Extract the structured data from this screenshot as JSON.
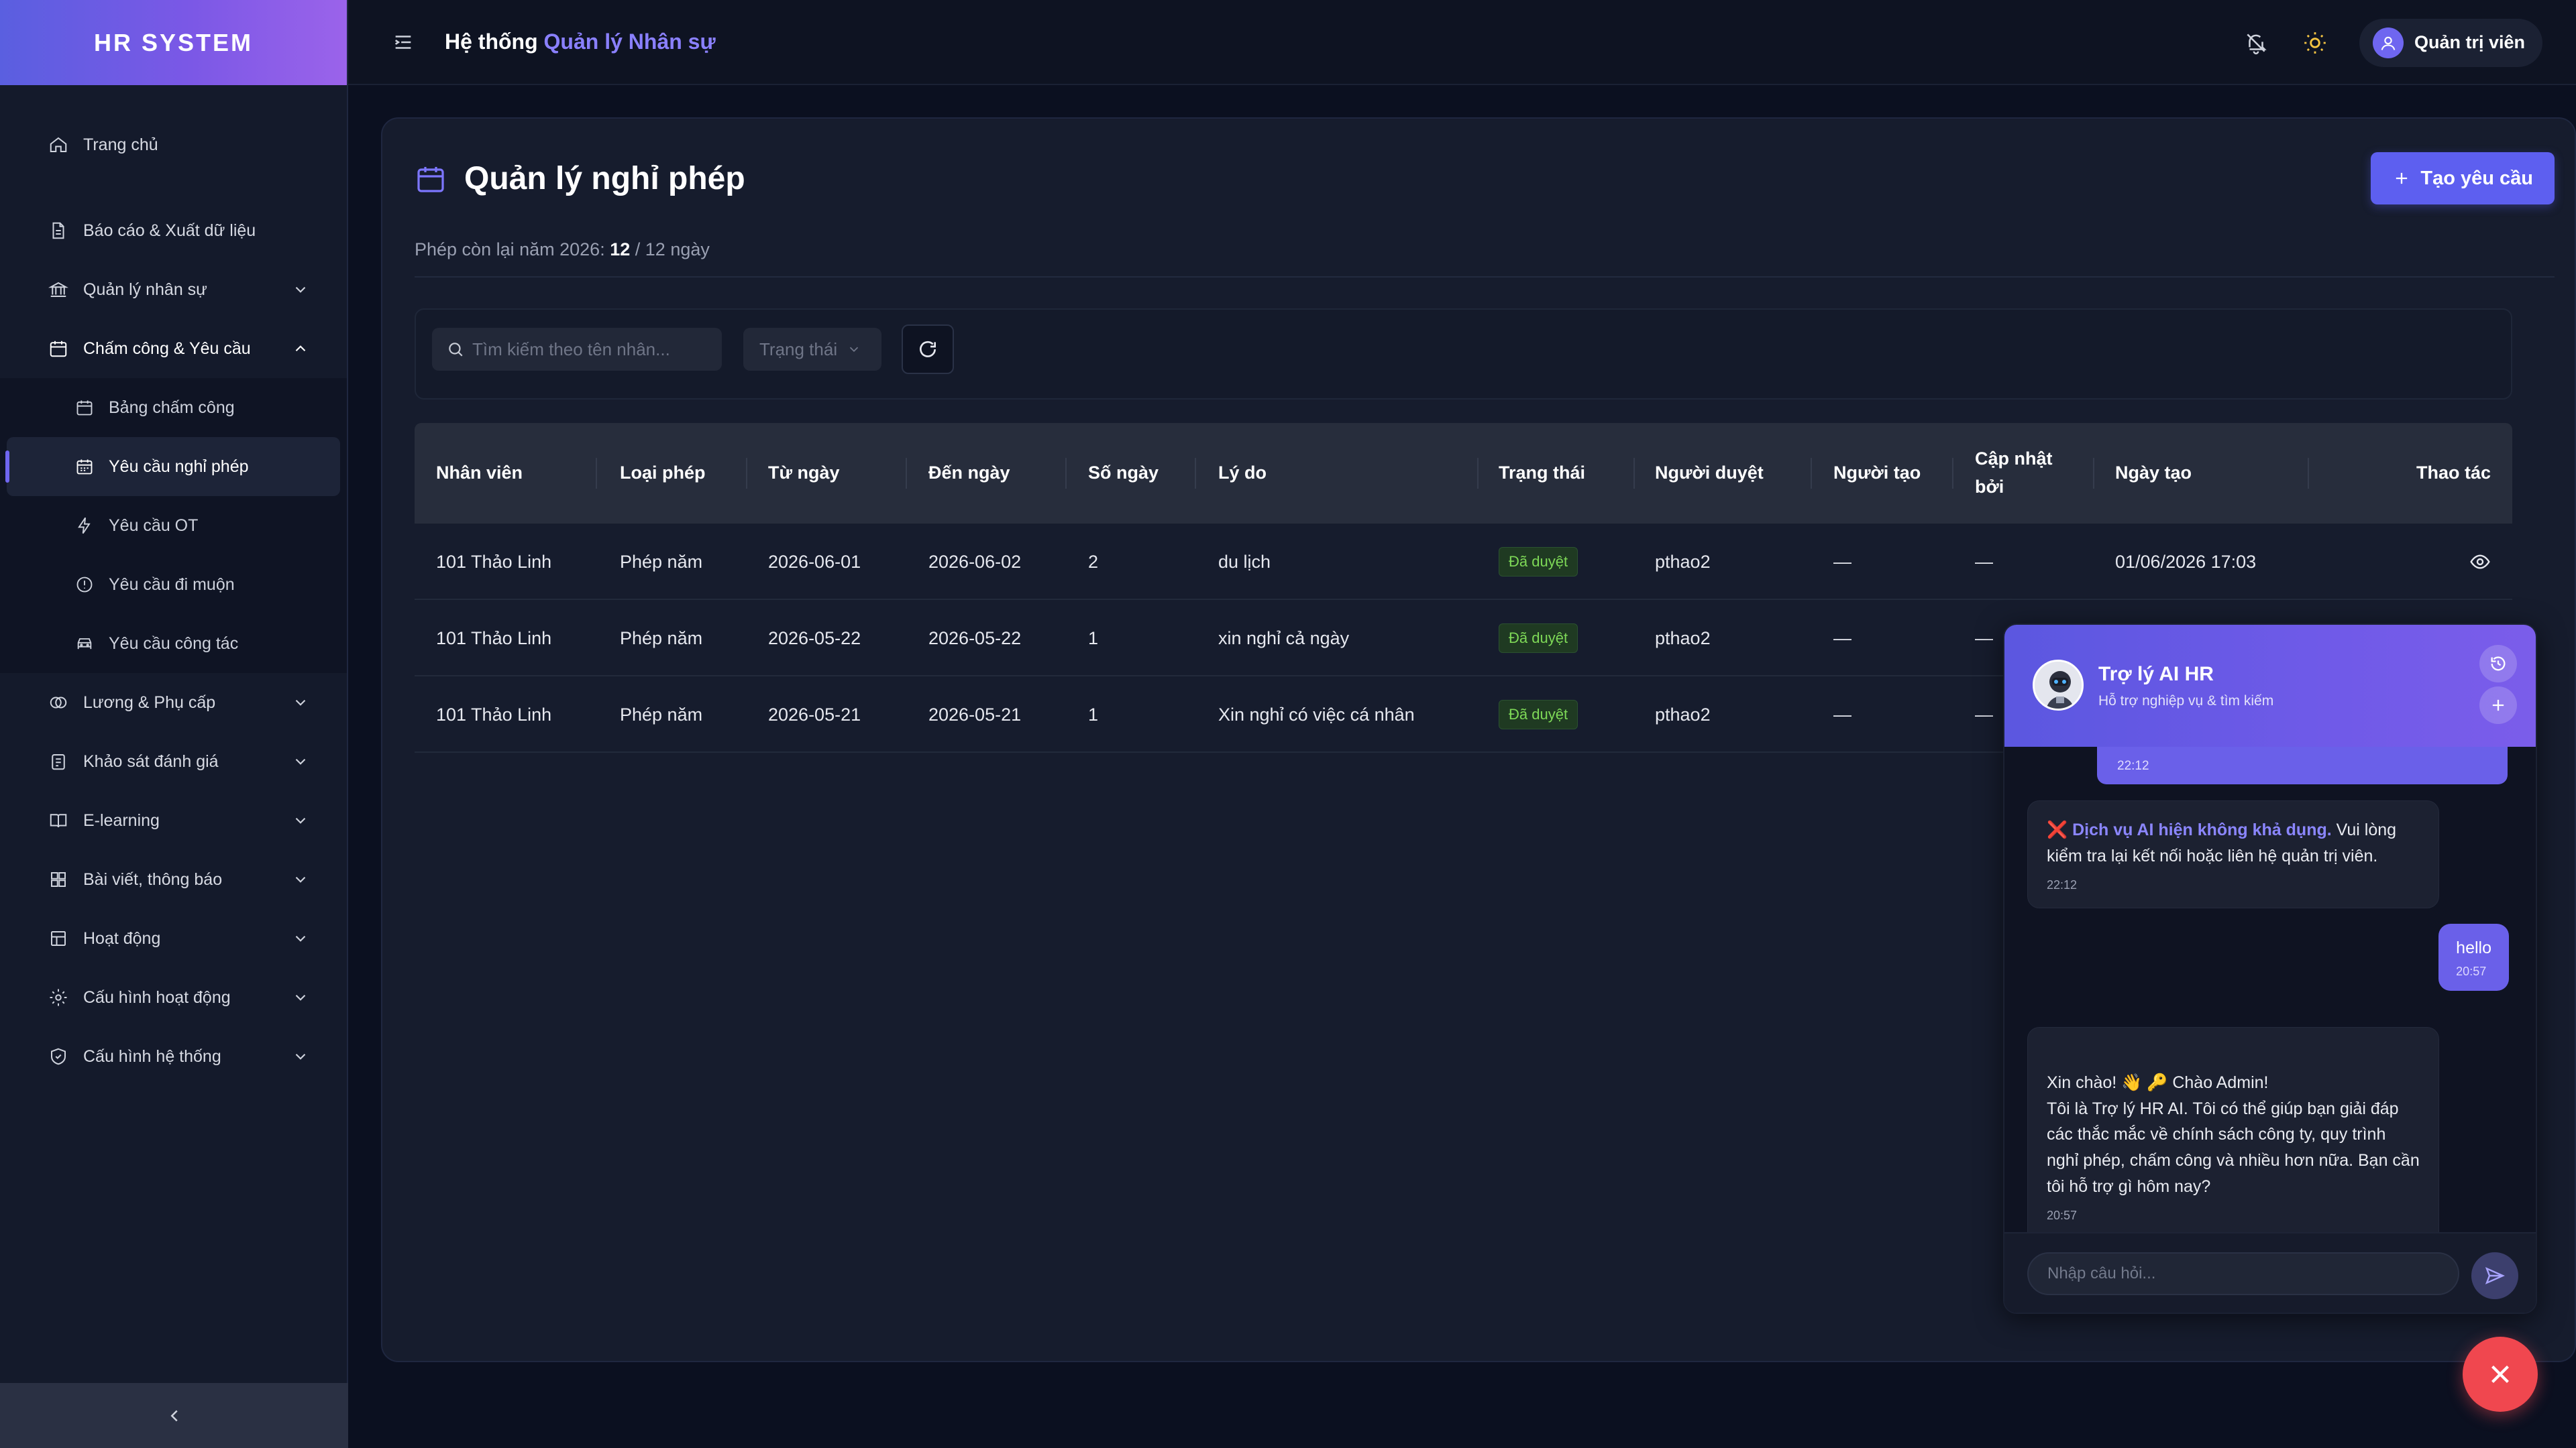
{
  "brand": "HR SYSTEM",
  "header": {
    "title_prefix": "Hệ thống",
    "title_accent": "Quản lý Nhân sự",
    "user_name": "Quản trị viên"
  },
  "sidebar": {
    "items": [
      {
        "label": "Trang chủ"
      },
      {
        "label": "Báo cáo & Xuất dữ liệu"
      },
      {
        "label": "Quản lý nhân sự"
      },
      {
        "label": "Chấm công & Yêu cầu"
      }
    ],
    "subitems": [
      {
        "label": "Bảng chấm công"
      },
      {
        "label": "Yêu cầu nghỉ phép"
      },
      {
        "label": "Yêu cầu OT"
      },
      {
        "label": "Yêu cầu đi muộn"
      },
      {
        "label": "Yêu cầu công tác"
      }
    ],
    "items_after": [
      {
        "label": "Lương & Phụ cấp"
      },
      {
        "label": "Khảo sát đánh giá"
      },
      {
        "label": "E-learning"
      },
      {
        "label": "Bài viết, thông báo"
      },
      {
        "label": "Hoạt động"
      },
      {
        "label": "Cấu hình hoạt động"
      },
      {
        "label": "Cấu hình hệ thống"
      }
    ]
  },
  "page": {
    "title": "Quản lý nghỉ phép",
    "create_label": "Tạo yêu cầu",
    "remain_prefix": "Phép còn lại năm 2026:",
    "remain_used": "12",
    "remain_suffix": "/ 12 ngày",
    "search_placeholder": "Tìm kiếm theo tên nhân...",
    "status_placeholder": "Trạng thái"
  },
  "table": {
    "columns": [
      "Nhân viên",
      "Loại phép",
      "Từ ngày",
      "Đến ngày",
      "Số ngày",
      "Lý do",
      "Trạng thái",
      "Người duyệt",
      "Người tạo",
      "Cập nhật\nbởi",
      "Ngày tạo",
      "Thao tác"
    ],
    "rows": [
      [
        "101 Thảo Linh",
        "Phép năm",
        "2026-06-01",
        "2026-06-02",
        "2",
        "du lịch",
        "Đã duyệt",
        "pthao2",
        "—",
        "—",
        "01/06/2026 17:03"
      ],
      [
        "101 Thảo Linh",
        "Phép năm",
        "2026-05-22",
        "2026-05-22",
        "1",
        "xin nghỉ cả ngày",
        "Đã duyệt",
        "pthao2",
        "—",
        "—",
        ""
      ],
      [
        "101 Thảo Linh",
        "Phép năm",
        "2026-05-21",
        "2026-05-21",
        "1",
        "Xin nghỉ có việc cá nhân",
        "Đã duyệt",
        "pthao2",
        "—",
        "—",
        ""
      ]
    ]
  },
  "chat": {
    "name": "Trợ lý AI HR",
    "subtitle": "Hỗ trợ nghiệp vụ & tìm kiếm",
    "cut_time": "22:12",
    "err_mark": "❌",
    "err_title": "Dịch vụ AI hiện không khả dụng.",
    "err_text": "Vui lòng kiểm tra lại kết nối hoặc liên hệ quản trị viên.",
    "err_time": "22:12",
    "user_text": "hello",
    "user_time": "20:57",
    "greet_text": "Xin chào! 👋 🔑 Chào Admin!\nTôi là Trợ lý HR AI. Tôi có thể giúp bạn giải đáp các thắc mắc về chính sách công ty, quy trình nghỉ phép, chấm công và nhiều hơn nữa. Bạn cần tôi hỗ trợ gì hôm nay?",
    "greet_time": "20:57",
    "input_placeholder": "Nhập câu hỏi..."
  },
  "colors": {
    "accent": "#6f66f0",
    "approved": "#7ed957",
    "danger": "#f0474f"
  }
}
